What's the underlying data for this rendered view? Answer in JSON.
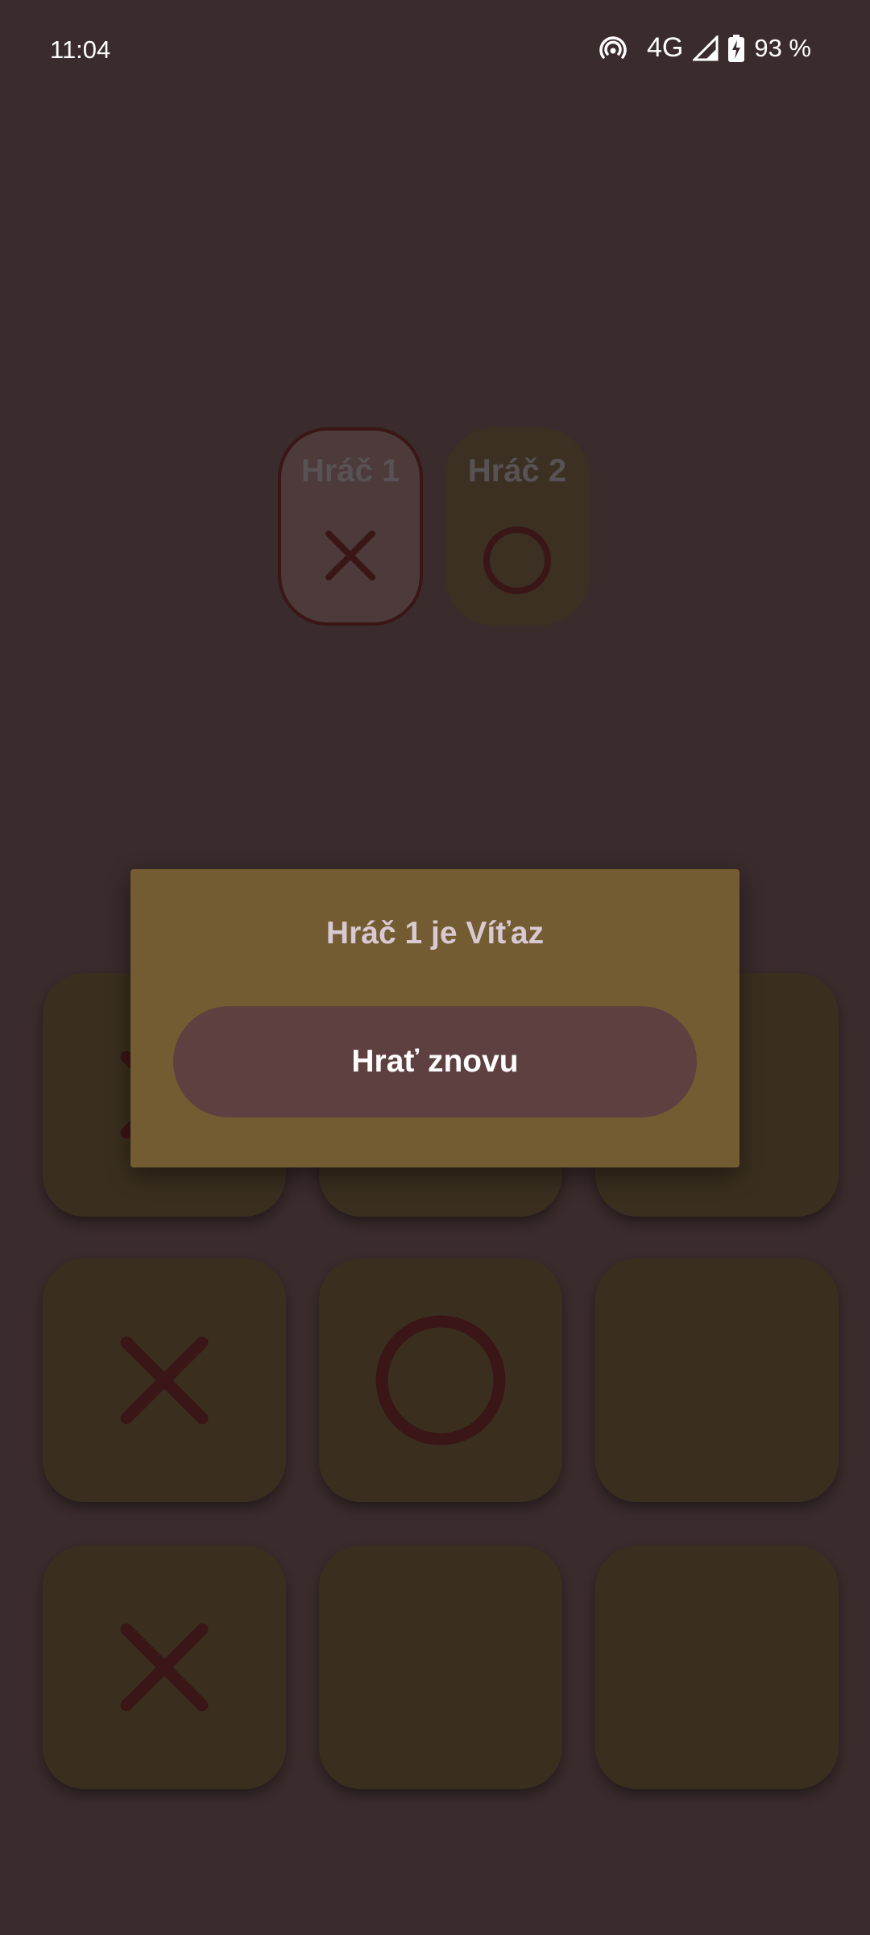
{
  "status_bar": {
    "time": "11:04",
    "network": "4G",
    "battery": "93 %",
    "icons": [
      "hotspot-icon",
      "signal-icon",
      "battery-charging-icon"
    ]
  },
  "players": [
    {
      "label": "Hráč 1",
      "mark": "X",
      "active": true
    },
    {
      "label": "Hráč 2",
      "mark": "O",
      "active": false
    }
  ],
  "board": [
    [
      "X",
      "",
      ""
    ],
    [
      "X",
      "O",
      ""
    ],
    [
      "X",
      "",
      ""
    ]
  ],
  "dialog": {
    "message": "Hráč 1 je Víťaz",
    "play_again_label": "Hrať znovu"
  },
  "colors": {
    "background": "#3a2b2c",
    "cell": "#3a2f1f",
    "mark": "#3a1617",
    "dialog": "#735c31",
    "button": "#5e4040"
  }
}
